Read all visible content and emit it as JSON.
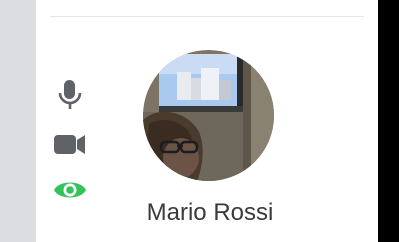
{
  "participant": {
    "name": "Mario Rossi",
    "avatar": "participant-video-thumbnail"
  },
  "controls": {
    "microphone": {
      "icon": "microphone-icon",
      "active": false
    },
    "camera": {
      "icon": "video-camera-icon",
      "active": false
    },
    "visibility": {
      "icon": "eye-icon",
      "active": true
    }
  },
  "colors": {
    "icon_inactive": "#5f6368",
    "icon_active": "#34c25a",
    "name_text": "#3a3a3a",
    "sidebar_gutter": "#dcdde0",
    "edge_strip": "#000000"
  }
}
